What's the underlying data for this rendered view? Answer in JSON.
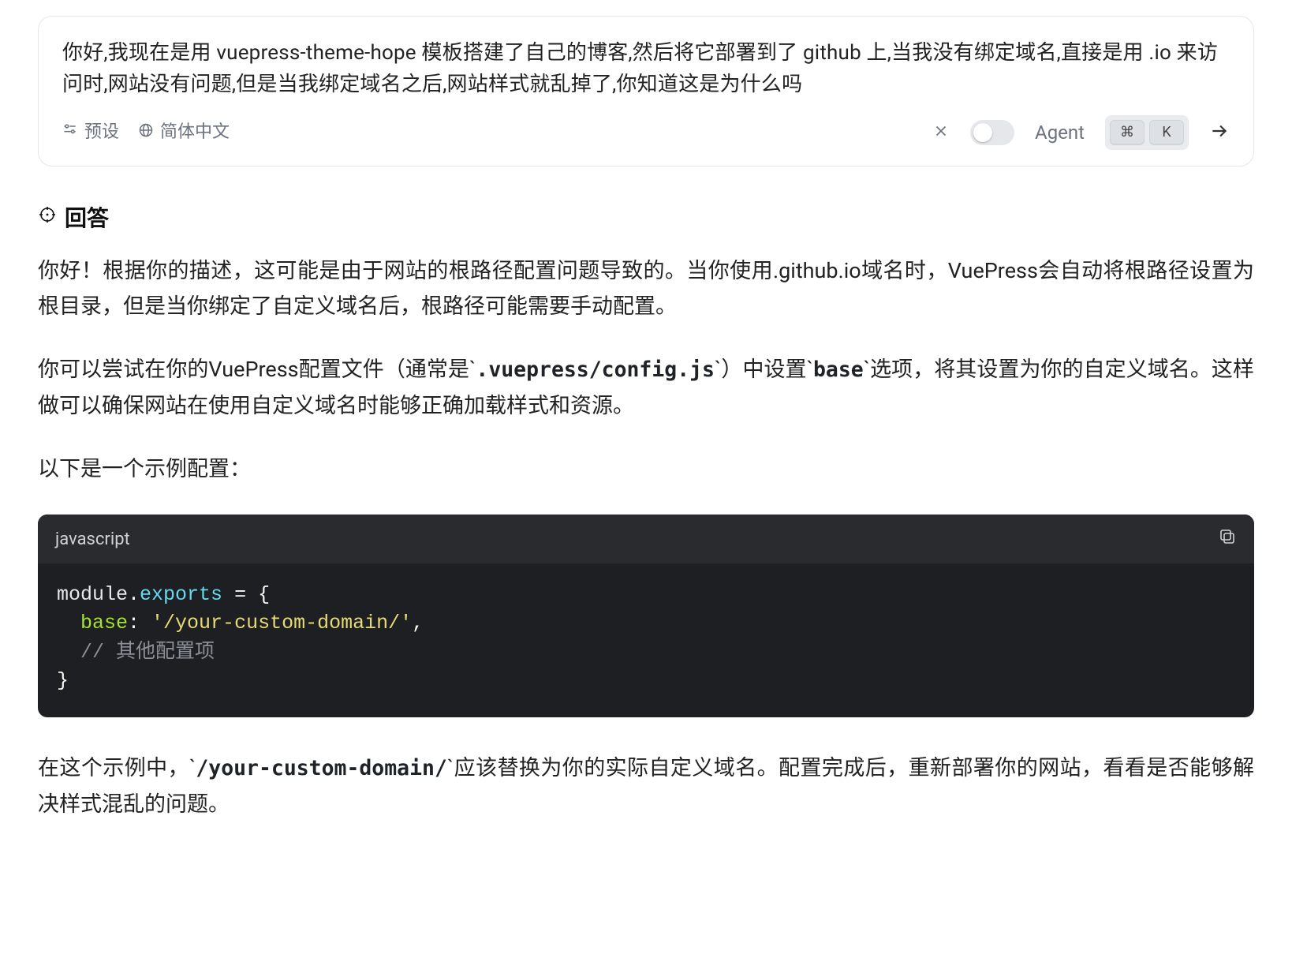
{
  "prompt": {
    "text": "你好,我现在是用 vuepress-theme-hope 模板搭建了自己的博客,然后将它部署到了 github 上,当我没有绑定域名,直接是用 .io 来访问时,网站没有问题,但是当我绑定域名之后,网站样式就乱掉了,你知道这是为什么吗",
    "toolbar": {
      "preset_label": "预设",
      "language_label": "简体中文",
      "agent_label": "Agent",
      "agent_toggle_on": false,
      "kbd_cmd": "⌘",
      "kbd_key": "K"
    }
  },
  "answer": {
    "heading": "回答",
    "p1": "你好！根据你的描述，这可能是由于网站的根路径配置问题导致的。当你使用.github.io域名时，VuePress会自动将根路径设置为根目录，但是当你绑定了自定义域名后，根路径可能需要手动配置。",
    "p2_pre": "你可以尝试在你的VuePress配置文件（通常是`",
    "p2_code1": ".vuepress/config.js",
    "p2_mid": "`）中设置`",
    "p2_code2": "base",
    "p2_post": "`选项，将其设置为你的自定义域名。这样做可以确保网站在使用自定义域名时能够正确加载样式和资源。",
    "p3": "以下是一个示例配置：",
    "p4_pre": "在这个示例中，`",
    "p4_code": "/your-custom-domain/",
    "p4_post": "`应该替换为你的实际自定义域名。配置完成后，重新部署你的网站，看看是否能够解决样式混乱的问题。"
  },
  "code": {
    "language": "javascript",
    "tokens": {
      "l1_module": "module",
      "l1_dot": ".",
      "l1_exports": "exports",
      "l1_assign": " = {",
      "l2_prop": "base",
      "l2_colon": ": ",
      "l2_string": "'/your-custom-domain/'",
      "l2_comma": ",",
      "l3_comment": "// 其他配置项",
      "l4_close": "}"
    }
  }
}
